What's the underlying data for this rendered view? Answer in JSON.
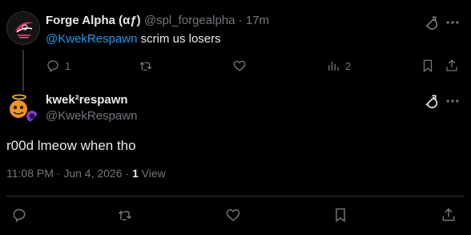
{
  "parent_tweet": {
    "display_name": "Forge Alpha (αƒ)",
    "handle": "@spl_forgealpha",
    "separator": "·",
    "time_ago": "17m",
    "mention": "@KwekRespawn",
    "text": " scrim us losers",
    "actions": {
      "reply_count": "1",
      "retweet_count": "",
      "like_count": "",
      "views_count": "2"
    },
    "icons": [
      "grok-icon",
      "more-icon",
      "reply-icon",
      "retweet-icon",
      "like-icon",
      "views-icon",
      "bookmark-icon",
      "share-icon"
    ]
  },
  "main_tweet": {
    "display_name": "kwek²respawn",
    "handle": "@KwekRespawn",
    "text": "r00d lmeow when tho",
    "timestamp": "11:08 PM · Jun 4, 2026 · ",
    "views_count": "1",
    "views_label": " View",
    "icons": [
      "grok-icon",
      "more-icon",
      "reply-icon",
      "retweet-icon",
      "like-icon",
      "bookmark-icon",
      "share-icon"
    ]
  },
  "colors": {
    "background": "#000000",
    "text": "#e7e9ea",
    "muted": "#71767b",
    "link": "#1d9bf0",
    "divider": "#2f3336"
  }
}
